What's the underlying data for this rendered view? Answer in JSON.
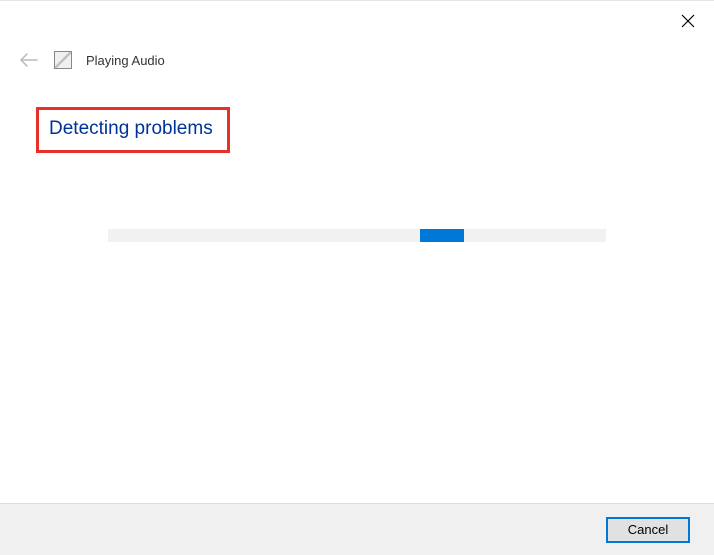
{
  "window": {
    "title": "Playing Audio"
  },
  "content": {
    "heading": "Detecting problems"
  },
  "footer": {
    "cancel_label": "Cancel"
  },
  "colors": {
    "heading_color": "#003399",
    "highlight_border": "#e8302a",
    "accent": "#0078d7"
  },
  "progress": {
    "mode": "indeterminate"
  }
}
